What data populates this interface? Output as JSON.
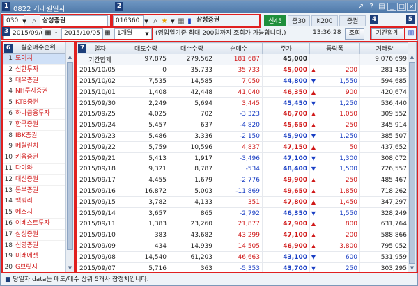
{
  "window": {
    "title": "0822 거래원일자"
  },
  "toolbar": {
    "broker_code": "030",
    "broker_name": "삼성증권",
    "stock_code": "016360",
    "stock_name": "삼성증권",
    "tabs": [
      "신45",
      "증30",
      "K200",
      "증권"
    ],
    "date_from": "2015/09/05",
    "date_sep": "-",
    "date_to": "2015/10/05",
    "period": "1개월",
    "notice": "(영업일기준 최대 200일까지 조회가 가능합니다.)",
    "time": "13:36:28",
    "search_label": "조회",
    "period_total_label": "기간합계"
  },
  "badges": [
    "1",
    "2",
    "3",
    "4",
    "5",
    "6",
    "7"
  ],
  "left_list": {
    "header": "실순매수순위",
    "items": [
      {
        "no": "1",
        "name": "도이치"
      },
      {
        "no": "2",
        "name": "신한투자"
      },
      {
        "no": "3",
        "name": "대우증권"
      },
      {
        "no": "4",
        "name": "NH투자증권"
      },
      {
        "no": "5",
        "name": "KTB증권"
      },
      {
        "no": "6",
        "name": "하나금융투자"
      },
      {
        "no": "7",
        "name": "한국증권"
      },
      {
        "no": "8",
        "name": "IBK증권"
      },
      {
        "no": "9",
        "name": "메릴린치"
      },
      {
        "no": "10",
        "name": "키움증권"
      },
      {
        "no": "11",
        "name": "다이와"
      },
      {
        "no": "12",
        "name": "대신증권"
      },
      {
        "no": "13",
        "name": "동부증권"
      },
      {
        "no": "14",
        "name": "맥쿼리"
      },
      {
        "no": "15",
        "name": "에스지"
      },
      {
        "no": "16",
        "name": "이베스트투자"
      },
      {
        "no": "17",
        "name": "삼성증권"
      },
      {
        "no": "18",
        "name": "신영증권"
      },
      {
        "no": "19",
        "name": "미래에셋"
      },
      {
        "no": "20",
        "name": "G브릿지"
      }
    ]
  },
  "table": {
    "columns": [
      "일자",
      "매도수량",
      "매수수량",
      "순매수",
      "주가",
      "등락폭",
      "거래량"
    ],
    "rows": [
      {
        "date": "기간합계",
        "sell": "97,875",
        "buy": "279,562",
        "net": "181,687",
        "net_color": "red",
        "price": "45,000",
        "price_color": "black",
        "dir": "",
        "chg": "",
        "chg_color": "",
        "vol": "9,076,699"
      },
      {
        "date": "2015/10/05",
        "sell": "0",
        "buy": "35,733",
        "net": "35,733",
        "net_color": "red",
        "price": "45,000",
        "price_color": "red",
        "dir": "▲",
        "chg": "200",
        "chg_color": "red",
        "vol": "281,435"
      },
      {
        "date": "2015/10/02",
        "sell": "7,535",
        "buy": "14,585",
        "net": "7,050",
        "net_color": "red",
        "price": "44,800",
        "price_color": "blue",
        "dir": "▼",
        "chg": "1,550",
        "chg_color": "blue",
        "vol": "594,685"
      },
      {
        "date": "2015/10/01",
        "sell": "1,408",
        "buy": "42,448",
        "net": "41,040",
        "net_color": "red",
        "price": "46,350",
        "price_color": "red",
        "dir": "▲",
        "chg": "900",
        "chg_color": "red",
        "vol": "420,674"
      },
      {
        "date": "2015/09/30",
        "sell": "2,249",
        "buy": "5,694",
        "net": "3,445",
        "net_color": "red",
        "price": "45,450",
        "price_color": "blue",
        "dir": "▼",
        "chg": "1,250",
        "chg_color": "blue",
        "vol": "536,440"
      },
      {
        "date": "2015/09/25",
        "sell": "4,025",
        "buy": "702",
        "net": "-3,323",
        "net_color": "blue",
        "price": "46,700",
        "price_color": "red",
        "dir": "▲",
        "chg": "1,050",
        "chg_color": "red",
        "vol": "309,552"
      },
      {
        "date": "2015/09/24",
        "sell": "5,457",
        "buy": "637",
        "net": "-4,820",
        "net_color": "blue",
        "price": "45,650",
        "price_color": "red",
        "dir": "▲",
        "chg": "250",
        "chg_color": "red",
        "vol": "345,914"
      },
      {
        "date": "2015/09/23",
        "sell": "5,486",
        "buy": "3,336",
        "net": "-2,150",
        "net_color": "blue",
        "price": "45,900",
        "price_color": "blue",
        "dir": "▼",
        "chg": "1,250",
        "chg_color": "blue",
        "vol": "385,507"
      },
      {
        "date": "2015/09/22",
        "sell": "5,759",
        "buy": "10,596",
        "net": "4,837",
        "net_color": "red",
        "price": "47,150",
        "price_color": "red",
        "dir": "▲",
        "chg": "50",
        "chg_color": "red",
        "vol": "437,652"
      },
      {
        "date": "2015/09/21",
        "sell": "5,413",
        "buy": "1,917",
        "net": "-3,496",
        "net_color": "blue",
        "price": "47,100",
        "price_color": "blue",
        "dir": "▼",
        "chg": "1,300",
        "chg_color": "blue",
        "vol": "308,072"
      },
      {
        "date": "2015/09/18",
        "sell": "9,321",
        "buy": "8,787",
        "net": "-534",
        "net_color": "blue",
        "price": "48,400",
        "price_color": "blue",
        "dir": "▼",
        "chg": "1,500",
        "chg_color": "blue",
        "vol": "726,557"
      },
      {
        "date": "2015/09/17",
        "sell": "4,455",
        "buy": "1,679",
        "net": "-2,776",
        "net_color": "blue",
        "price": "49,900",
        "price_color": "red",
        "dir": "▲",
        "chg": "250",
        "chg_color": "red",
        "vol": "485,467"
      },
      {
        "date": "2015/09/16",
        "sell": "16,872",
        "buy": "5,003",
        "net": "-11,869",
        "net_color": "blue",
        "price": "49,650",
        "price_color": "red",
        "dir": "▲",
        "chg": "1,850",
        "chg_color": "red",
        "vol": "718,262"
      },
      {
        "date": "2015/09/15",
        "sell": "3,782",
        "buy": "4,133",
        "net": "351",
        "net_color": "red",
        "price": "47,800",
        "price_color": "red",
        "dir": "▲",
        "chg": "1,450",
        "chg_color": "red",
        "vol": "347,297"
      },
      {
        "date": "2015/09/14",
        "sell": "3,657",
        "buy": "865",
        "net": "-2,792",
        "net_color": "blue",
        "price": "46,350",
        "price_color": "blue",
        "dir": "▼",
        "chg": "1,550",
        "chg_color": "blue",
        "vol": "328,249"
      },
      {
        "date": "2015/09/11",
        "sell": "1,383",
        "buy": "23,260",
        "net": "21,877",
        "net_color": "red",
        "price": "47,900",
        "price_color": "red",
        "dir": "▲",
        "chg": "800",
        "chg_color": "red",
        "vol": "631,764"
      },
      {
        "date": "2015/09/10",
        "sell": "383",
        "buy": "43,682",
        "net": "43,299",
        "net_color": "red",
        "price": "47,100",
        "price_color": "red",
        "dir": "▲",
        "chg": "200",
        "chg_color": "red",
        "vol": "588,866"
      },
      {
        "date": "2015/09/09",
        "sell": "434",
        "buy": "14,939",
        "net": "14,505",
        "net_color": "red",
        "price": "46,900",
        "price_color": "red",
        "dir": "▲",
        "chg": "3,800",
        "chg_color": "red",
        "vol": "795,052"
      },
      {
        "date": "2015/09/08",
        "sell": "14,540",
        "buy": "61,203",
        "net": "46,663",
        "net_color": "red",
        "price": "43,100",
        "price_color": "blue",
        "dir": "▼",
        "chg": "600",
        "chg_color": "blue",
        "vol": "531,959"
      },
      {
        "date": "2015/09/07",
        "sell": "5,716",
        "buy": "363",
        "net": "-5,353",
        "net_color": "blue",
        "price": "43,700",
        "price_color": "blue",
        "dir": "▼",
        "chg": "250",
        "chg_color": "blue",
        "vol": "303,295"
      }
    ]
  },
  "status": {
    "text": "당일자 data는 매도/매수 상위 5개사 잠정치입니다."
  },
  "colors": {
    "red": "#d01818",
    "blue": "#1a3fc4",
    "accent_green": "#1f8f3c",
    "badge": "#1c3e7a"
  }
}
